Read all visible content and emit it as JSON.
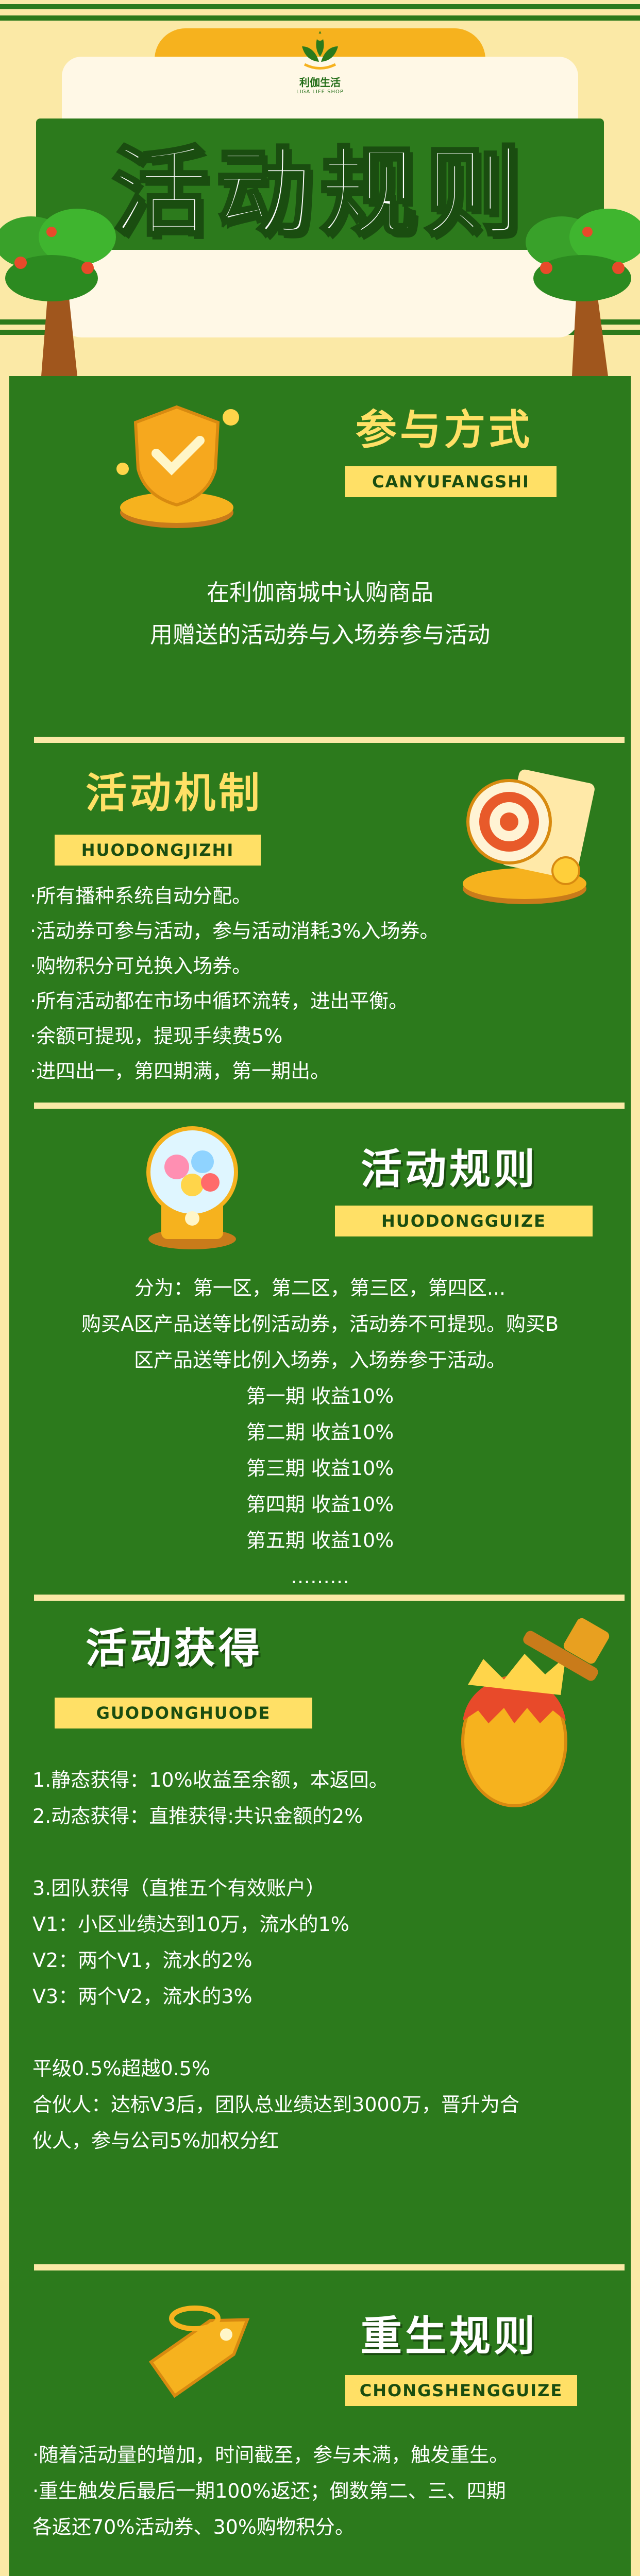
{
  "header": {
    "logo_name": "利伽生活",
    "logo_sub": "LIGA LIFE SHOP",
    "title": "活动规则"
  },
  "sections": {
    "participation": {
      "title": "参与方式",
      "pinyin": "CANYUFANGSHI",
      "lines": [
        "在利伽商城中认购商品",
        "用赠送的活动券与入场券参与活动"
      ]
    },
    "mechanism": {
      "title": "活动机制",
      "pinyin": "HUODONGJIZHI",
      "lines": [
        "·所有播种系统自动分配。",
        "·活动券可参与活动，参与活动消耗3%入场券。",
        "·购物积分可兑换入场券。",
        "·所有活动都在市场中循环流转，进出平衡。",
        "·余额可提现，提现手续费5%",
        "·进四出一，第四期满，第一期出。"
      ]
    },
    "rules": {
      "title": "活动规则",
      "pinyin": "HUODONGGUIZE",
      "lines": [
        "分为：第一区，第二区，第三区，第四区...",
        "购买A区产品送等比例活动券，活动券不可提现。购买B",
        "区产品送等比例入场券，入场券参于活动。",
        "第一期  收益10%",
        "第二期  收益10%",
        "第三期  收益10%",
        "第四期  收益10%",
        "第五期  收益10%",
        "………"
      ]
    },
    "gains": {
      "title": "活动获得",
      "pinyin": "GUODONGHUODE",
      "lines": [
        "1.静态获得：10%收益至余额，本返回。",
        "2.动态获得：直推获得:共识金额的2%",
        "",
        "3.团队获得（直推五个有效账户）",
        "V1：小区业绩达到10万，流水的1%",
        "V2：两个V1，流水的2%",
        "V3：两个V2，流水的3%",
        "",
        "平级0.5%超越0.5%",
        "合伙人：达标V3后，团队总业绩达到3000万，晋升为合",
        "伙人，参与公司5%加权分红"
      ]
    },
    "rebirth": {
      "title": "重生规则",
      "pinyin": "CHONGSHENGGUIZE",
      "lines": [
        "·随着活动量的增加，时间截至，参与未满，触发重生。",
        "·重生触发后最后一期100%返还；倒数第二、三、四期",
        "各返还70%活动券、30%购物积分。"
      ]
    }
  },
  "colors": {
    "green": "#2c7a1c",
    "dark_green": "#1a4d10",
    "cream": "#fbe9a6",
    "gold": "#ffe066",
    "orange": "#f6b21e"
  },
  "icons": [
    "shield-check-icon",
    "target-icon",
    "gacha-machine-icon",
    "golden-egg-hammer-icon",
    "tag-icon",
    "tree-icon"
  ]
}
